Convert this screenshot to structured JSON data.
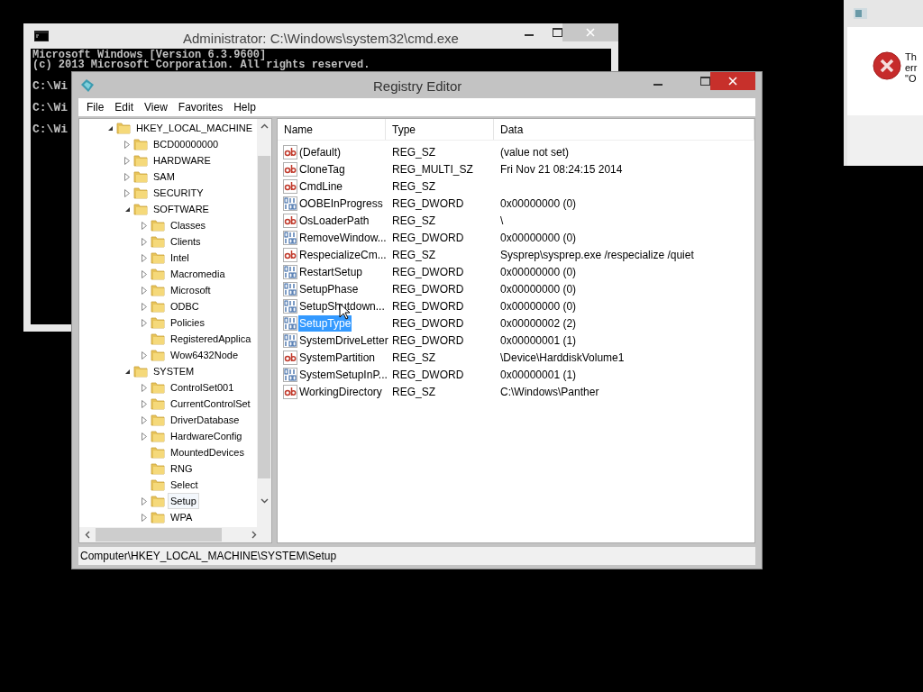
{
  "console": {
    "title": "Administrator: C:\\Windows\\system32\\cmd.exe",
    "header": [
      "Microsoft Windows [Version 6.3.9600]",
      "(c) 2013 Microsoft Corporation. All rights reserved."
    ],
    "prompts": [
      "C:\\Wi",
      "C:\\Wi",
      "C:\\Wi"
    ]
  },
  "registry": {
    "title": "Registry Editor",
    "menu": [
      "File",
      "Edit",
      "View",
      "Favorites",
      "Help"
    ],
    "tree": [
      {
        "label": "HKEY_LOCAL_MACHINE",
        "expandable": true,
        "expanded": true,
        "selected": false,
        "children": [
          {
            "label": "BCD00000000",
            "expandable": true,
            "expanded": false,
            "selected": false
          },
          {
            "label": "HARDWARE",
            "expandable": true,
            "expanded": false,
            "selected": false
          },
          {
            "label": "SAM",
            "expandable": true,
            "expanded": false,
            "selected": false
          },
          {
            "label": "SECURITY",
            "expandable": true,
            "expanded": false,
            "selected": false
          },
          {
            "label": "SOFTWARE",
            "expandable": true,
            "expanded": true,
            "selected": false,
            "children": [
              {
                "label": "Classes",
                "expandable": true,
                "expanded": false,
                "selected": false
              },
              {
                "label": "Clients",
                "expandable": true,
                "expanded": false,
                "selected": false
              },
              {
                "label": "Intel",
                "expandable": true,
                "expanded": false,
                "selected": false
              },
              {
                "label": "Macromedia",
                "expandable": true,
                "expanded": false,
                "selected": false
              },
              {
                "label": "Microsoft",
                "expandable": true,
                "expanded": false,
                "selected": false
              },
              {
                "label": "ODBC",
                "expandable": true,
                "expanded": false,
                "selected": false
              },
              {
                "label": "Policies",
                "expandable": true,
                "expanded": false,
                "selected": false
              },
              {
                "label": "RegisteredApplica",
                "expandable": false,
                "selected": false
              },
              {
                "label": "Wow6432Node",
                "expandable": true,
                "expanded": false,
                "selected": false
              }
            ]
          },
          {
            "label": "SYSTEM",
            "expandable": true,
            "expanded": true,
            "selected": false,
            "children": [
              {
                "label": "ControlSet001",
                "expandable": true,
                "expanded": false,
                "selected": false
              },
              {
                "label": "CurrentControlSet",
                "expandable": true,
                "expanded": false,
                "selected": false
              },
              {
                "label": "DriverDatabase",
                "expandable": true,
                "expanded": false,
                "selected": false
              },
              {
                "label": "HardwareConfig",
                "expandable": true,
                "expanded": false,
                "selected": false
              },
              {
                "label": "MountedDevices",
                "expandable": false,
                "selected": false
              },
              {
                "label": "RNG",
                "expandable": false,
                "selected": false
              },
              {
                "label": "Select",
                "expandable": false,
                "selected": false
              },
              {
                "label": "Setup",
                "expandable": true,
                "expanded": false,
                "selected": true
              },
              {
                "label": "WPA",
                "expandable": true,
                "expanded": false,
                "selected": false
              }
            ]
          }
        ]
      }
    ],
    "columns": [
      "Name",
      "Type",
      "Data"
    ],
    "values": [
      {
        "kind": "string",
        "name": "(Default)",
        "type": "REG_SZ",
        "data": "(value not set)",
        "selected": false
      },
      {
        "kind": "string",
        "name": "CloneTag",
        "type": "REG_MULTI_SZ",
        "data": "Fri Nov 21 08:24:15 2014",
        "selected": false
      },
      {
        "kind": "string",
        "name": "CmdLine",
        "type": "REG_SZ",
        "selected": false
      },
      {
        "kind": "binary",
        "name": "OOBEInProgress",
        "type": "REG_DWORD",
        "data": "0x00000000 (0)",
        "selected": false
      },
      {
        "kind": "string",
        "name": "OsLoaderPath",
        "type": "REG_SZ",
        "data": "\\",
        "selected": false
      },
      {
        "kind": "binary",
        "name": "RemoveWindow...",
        "type": "REG_DWORD",
        "data": "0x00000000 (0)",
        "selected": false
      },
      {
        "kind": "string",
        "name": "RespecializeCm...",
        "type": "REG_SZ",
        "data": "Sysprep\\sysprep.exe /respecialize /quiet",
        "selected": false
      },
      {
        "kind": "binary",
        "name": "RestartSetup",
        "type": "REG_DWORD",
        "data": "0x00000000 (0)",
        "selected": false
      },
      {
        "kind": "binary",
        "name": "SetupPhase",
        "type": "REG_DWORD",
        "data": "0x00000000 (0)",
        "selected": false
      },
      {
        "kind": "binary",
        "name": "SetupShutdown...",
        "type": "REG_DWORD",
        "data": "0x00000000 (0)",
        "selected": false
      },
      {
        "kind": "binary",
        "name": "SetupType",
        "type": "REG_DWORD",
        "data": "0x00000002 (2)",
        "selected": true
      },
      {
        "kind": "binary",
        "name": "SystemDriveLetter",
        "type": "REG_DWORD",
        "data": "0x00000001 (1)",
        "selected": false
      },
      {
        "kind": "string",
        "name": "SystemPartition",
        "type": "REG_SZ",
        "data": "\\Device\\HarddiskVolume1",
        "selected": false
      },
      {
        "kind": "binary",
        "name": "SystemSetupInP...",
        "type": "REG_DWORD",
        "data": "0x00000001 (1)",
        "selected": false
      },
      {
        "kind": "string",
        "name": "WorkingDirectory",
        "type": "REG_SZ",
        "data": "C:\\Windows\\Panther",
        "selected": false
      }
    ],
    "status_bar": "Computer\\HKEY_LOCAL_MACHINE\\SYSTEM\\Setup"
  },
  "dialog": {
    "lines": [
      "Th",
      "err",
      "\"O"
    ]
  }
}
